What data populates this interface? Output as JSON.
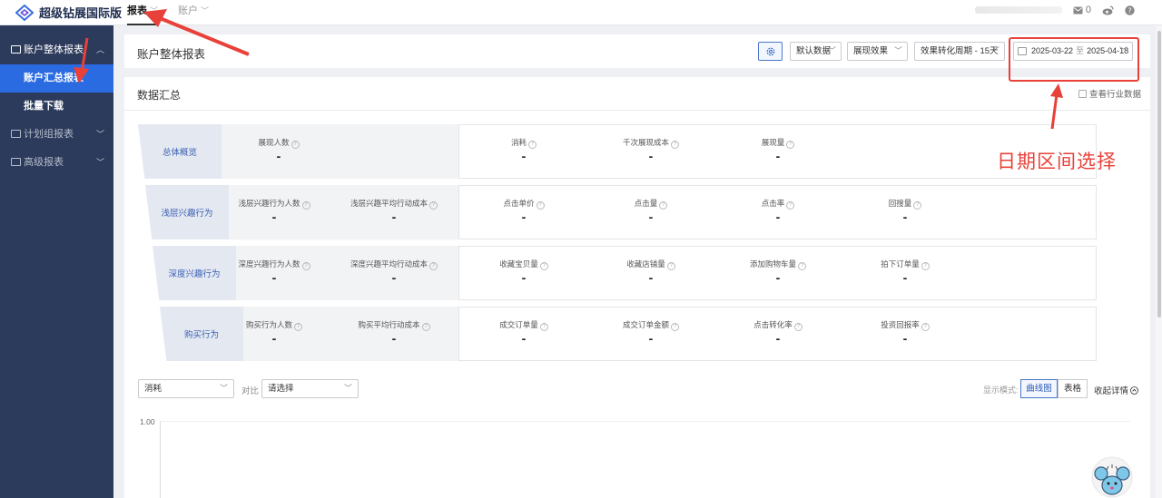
{
  "app": {
    "title": "超级钻展国际版"
  },
  "topnav": [
    {
      "label": "报表",
      "active": true
    },
    {
      "label": "账户",
      "active": false
    }
  ],
  "topbar": {
    "badge_count": "0"
  },
  "sidebar": {
    "groups": [
      {
        "label": "账户整体报表",
        "expanded": true,
        "items": [
          {
            "label": "账户汇总报表",
            "active": true
          },
          {
            "label": "批量下载",
            "active": false
          }
        ]
      },
      {
        "label": "计划组报表",
        "expanded": false
      },
      {
        "label": "高级报表",
        "expanded": false
      }
    ]
  },
  "header": {
    "title": "账户整体报表",
    "selects": [
      "默认数据",
      "展现效果",
      "效果转化周期 - 15天"
    ],
    "date_range": {
      "start": "2025-03-22",
      "separator": "至",
      "end": "2025-04-18"
    }
  },
  "summary": {
    "title": "数据汇总",
    "industry_checkbox": "查看行业数据",
    "rows": [
      {
        "label": "总体概览",
        "gray": [
          {
            "label": "展现人数",
            "value": "-"
          }
        ],
        "white": [
          {
            "label": "消耗",
            "value": "-"
          },
          {
            "label": "千次展现成本",
            "value": "-"
          },
          {
            "label": "展现量",
            "value": "-"
          }
        ]
      },
      {
        "label": "浅层兴趣行为",
        "gray": [
          {
            "label": "浅层兴趣行为人数",
            "value": "-"
          },
          {
            "label": "浅层兴趣平均行动成本",
            "value": "-"
          }
        ],
        "white": [
          {
            "label": "点击单价",
            "value": "-"
          },
          {
            "label": "点击量",
            "value": "-"
          },
          {
            "label": "点击率",
            "value": "-"
          },
          {
            "label": "回搜量",
            "value": "-"
          }
        ]
      },
      {
        "label": "深度兴趣行为",
        "gray": [
          {
            "label": "深度兴趣行为人数",
            "value": "-"
          },
          {
            "label": "深度兴趣平均行动成本",
            "value": "-"
          }
        ],
        "white": [
          {
            "label": "收藏宝贝量",
            "value": "-"
          },
          {
            "label": "收藏店铺量",
            "value": "-"
          },
          {
            "label": "添加购物车量",
            "value": "-"
          },
          {
            "label": "拍下订单量",
            "value": "-"
          }
        ]
      },
      {
        "label": "购买行为",
        "gray": [
          {
            "label": "购买行为人数",
            "value": "-"
          },
          {
            "label": "购买平均行动成本",
            "value": "-"
          }
        ],
        "white": [
          {
            "label": "成交订单量",
            "value": "-"
          },
          {
            "label": "成交订单金额",
            "value": "-"
          },
          {
            "label": "点击转化率",
            "value": "-"
          },
          {
            "label": "投资回报率",
            "value": "-"
          }
        ]
      }
    ]
  },
  "chart_controls": {
    "metric_select": "消耗",
    "compare_label": "对比",
    "compare_select": "请选择",
    "mode_label": "显示模式:",
    "modes": [
      {
        "label": "曲线图",
        "active": true
      },
      {
        "label": "表格",
        "active": false
      }
    ],
    "collapse_label": "收起详情",
    "y_tick": "1.00"
  },
  "annotation": {
    "text": "日期区间选择",
    "color": "#e8413a"
  },
  "colors": {
    "sidebar_bg": "#2c3a5b",
    "accent": "#2b6be2",
    "annotation_red": "#e8413a"
  }
}
